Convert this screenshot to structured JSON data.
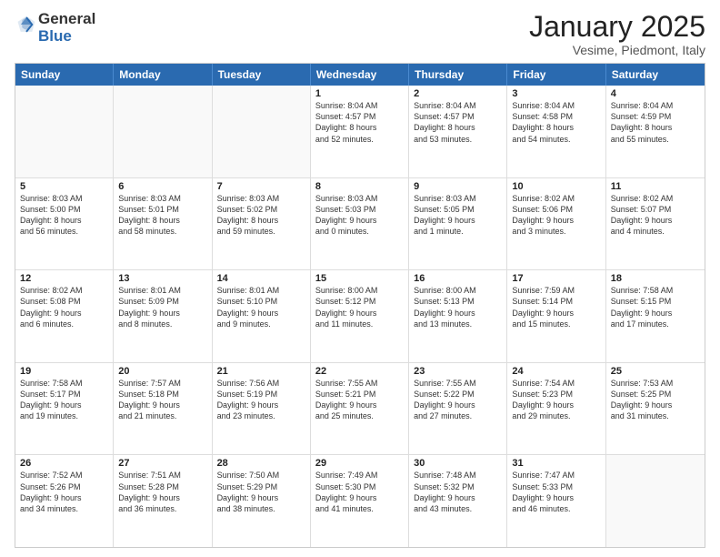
{
  "header": {
    "logo_general": "General",
    "logo_blue": "Blue",
    "month_title": "January 2025",
    "location": "Vesime, Piedmont, Italy"
  },
  "days_of_week": [
    "Sunday",
    "Monday",
    "Tuesday",
    "Wednesday",
    "Thursday",
    "Friday",
    "Saturday"
  ],
  "weeks": [
    [
      {
        "day": "",
        "text": ""
      },
      {
        "day": "",
        "text": ""
      },
      {
        "day": "",
        "text": ""
      },
      {
        "day": "1",
        "text": "Sunrise: 8:04 AM\nSunset: 4:57 PM\nDaylight: 8 hours\nand 52 minutes."
      },
      {
        "day": "2",
        "text": "Sunrise: 8:04 AM\nSunset: 4:57 PM\nDaylight: 8 hours\nand 53 minutes."
      },
      {
        "day": "3",
        "text": "Sunrise: 8:04 AM\nSunset: 4:58 PM\nDaylight: 8 hours\nand 54 minutes."
      },
      {
        "day": "4",
        "text": "Sunrise: 8:04 AM\nSunset: 4:59 PM\nDaylight: 8 hours\nand 55 minutes."
      }
    ],
    [
      {
        "day": "5",
        "text": "Sunrise: 8:03 AM\nSunset: 5:00 PM\nDaylight: 8 hours\nand 56 minutes."
      },
      {
        "day": "6",
        "text": "Sunrise: 8:03 AM\nSunset: 5:01 PM\nDaylight: 8 hours\nand 58 minutes."
      },
      {
        "day": "7",
        "text": "Sunrise: 8:03 AM\nSunset: 5:02 PM\nDaylight: 8 hours\nand 59 minutes."
      },
      {
        "day": "8",
        "text": "Sunrise: 8:03 AM\nSunset: 5:03 PM\nDaylight: 9 hours\nand 0 minutes."
      },
      {
        "day": "9",
        "text": "Sunrise: 8:03 AM\nSunset: 5:05 PM\nDaylight: 9 hours\nand 1 minute."
      },
      {
        "day": "10",
        "text": "Sunrise: 8:02 AM\nSunset: 5:06 PM\nDaylight: 9 hours\nand 3 minutes."
      },
      {
        "day": "11",
        "text": "Sunrise: 8:02 AM\nSunset: 5:07 PM\nDaylight: 9 hours\nand 4 minutes."
      }
    ],
    [
      {
        "day": "12",
        "text": "Sunrise: 8:02 AM\nSunset: 5:08 PM\nDaylight: 9 hours\nand 6 minutes."
      },
      {
        "day": "13",
        "text": "Sunrise: 8:01 AM\nSunset: 5:09 PM\nDaylight: 9 hours\nand 8 minutes."
      },
      {
        "day": "14",
        "text": "Sunrise: 8:01 AM\nSunset: 5:10 PM\nDaylight: 9 hours\nand 9 minutes."
      },
      {
        "day": "15",
        "text": "Sunrise: 8:00 AM\nSunset: 5:12 PM\nDaylight: 9 hours\nand 11 minutes."
      },
      {
        "day": "16",
        "text": "Sunrise: 8:00 AM\nSunset: 5:13 PM\nDaylight: 9 hours\nand 13 minutes."
      },
      {
        "day": "17",
        "text": "Sunrise: 7:59 AM\nSunset: 5:14 PM\nDaylight: 9 hours\nand 15 minutes."
      },
      {
        "day": "18",
        "text": "Sunrise: 7:58 AM\nSunset: 5:15 PM\nDaylight: 9 hours\nand 17 minutes."
      }
    ],
    [
      {
        "day": "19",
        "text": "Sunrise: 7:58 AM\nSunset: 5:17 PM\nDaylight: 9 hours\nand 19 minutes."
      },
      {
        "day": "20",
        "text": "Sunrise: 7:57 AM\nSunset: 5:18 PM\nDaylight: 9 hours\nand 21 minutes."
      },
      {
        "day": "21",
        "text": "Sunrise: 7:56 AM\nSunset: 5:19 PM\nDaylight: 9 hours\nand 23 minutes."
      },
      {
        "day": "22",
        "text": "Sunrise: 7:55 AM\nSunset: 5:21 PM\nDaylight: 9 hours\nand 25 minutes."
      },
      {
        "day": "23",
        "text": "Sunrise: 7:55 AM\nSunset: 5:22 PM\nDaylight: 9 hours\nand 27 minutes."
      },
      {
        "day": "24",
        "text": "Sunrise: 7:54 AM\nSunset: 5:23 PM\nDaylight: 9 hours\nand 29 minutes."
      },
      {
        "day": "25",
        "text": "Sunrise: 7:53 AM\nSunset: 5:25 PM\nDaylight: 9 hours\nand 31 minutes."
      }
    ],
    [
      {
        "day": "26",
        "text": "Sunrise: 7:52 AM\nSunset: 5:26 PM\nDaylight: 9 hours\nand 34 minutes."
      },
      {
        "day": "27",
        "text": "Sunrise: 7:51 AM\nSunset: 5:28 PM\nDaylight: 9 hours\nand 36 minutes."
      },
      {
        "day": "28",
        "text": "Sunrise: 7:50 AM\nSunset: 5:29 PM\nDaylight: 9 hours\nand 38 minutes."
      },
      {
        "day": "29",
        "text": "Sunrise: 7:49 AM\nSunset: 5:30 PM\nDaylight: 9 hours\nand 41 minutes."
      },
      {
        "day": "30",
        "text": "Sunrise: 7:48 AM\nSunset: 5:32 PM\nDaylight: 9 hours\nand 43 minutes."
      },
      {
        "day": "31",
        "text": "Sunrise: 7:47 AM\nSunset: 5:33 PM\nDaylight: 9 hours\nand 46 minutes."
      },
      {
        "day": "",
        "text": ""
      }
    ]
  ]
}
